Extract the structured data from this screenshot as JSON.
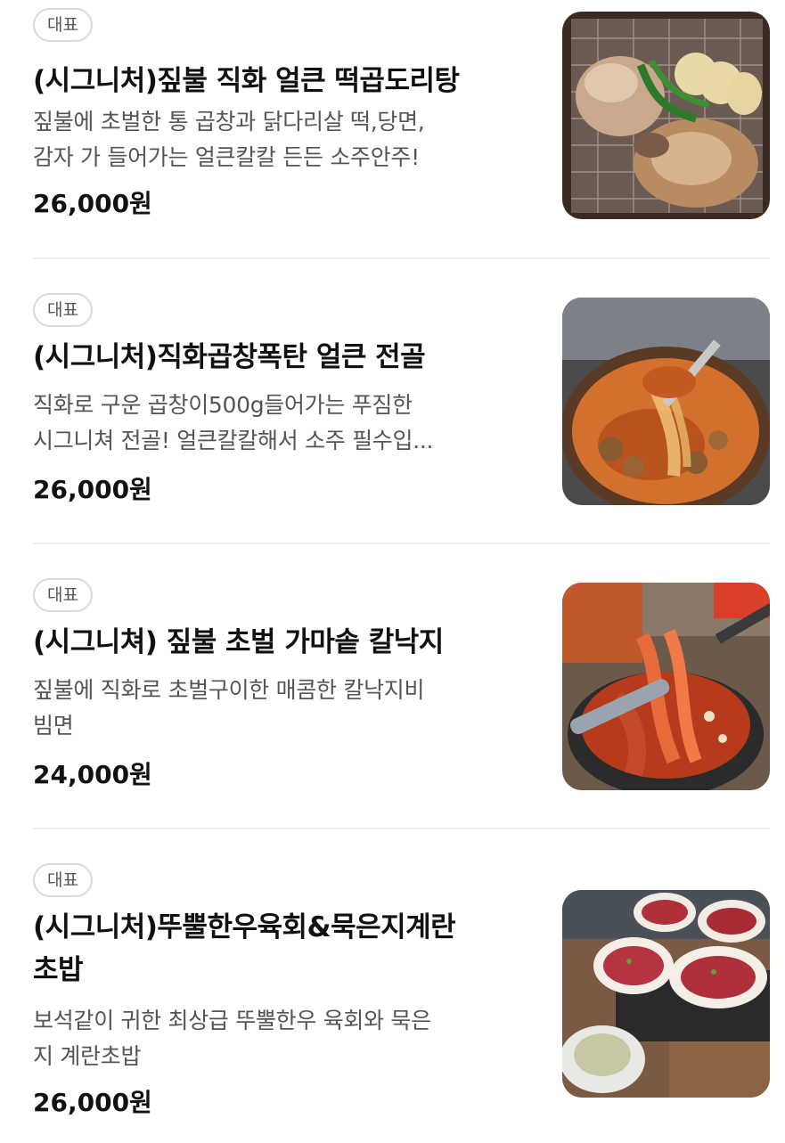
{
  "menu": [
    {
      "badge": "대표",
      "title": "(시그니처)짚불 직화 얼큰 떡곱도리탕",
      "desc_lines": [
        "짚불에 초벌한 통 곱창과 닭다리살 떡,당면,",
        "감자 가 들어가는 얼큰칼칼 든든 소주안주!"
      ],
      "price": "26,000원",
      "image_icon": "grilled-tripe-chicken-photo"
    },
    {
      "badge": "대표",
      "title": "(시그니처)직화곱창폭탄 얼큰 전골",
      "desc_lines": [
        "직화로 구운 곱창이500g들어가는 푸짐한",
        "시그니쳐 전골! 얼큰칼칼해서 소주 필수입..."
      ],
      "price": "26,000원",
      "image_icon": "tripe-hotpot-photo"
    },
    {
      "badge": "대표",
      "title": "(시그니쳐) 짚불 초벌 가마솥 칼낙지",
      "desc_lines": [
        "짚불에 직화로 초벌구이한 매콤한 칼낙지비",
        "빔면"
      ],
      "price": "24,000원",
      "image_icon": "spicy-octopus-noodle-photo"
    },
    {
      "badge": "대표",
      "title_lines": [
        "(시그니처)뚜뿔한우육회&묵은지계란",
        "초밥"
      ],
      "desc_lines": [
        "보석같이 귀한 최상급 뚜뿔한우 육회와 묵은",
        "지 계란초밥"
      ],
      "price": "26,000원",
      "image_icon": "beef-tartare-sushi-photo"
    }
  ]
}
